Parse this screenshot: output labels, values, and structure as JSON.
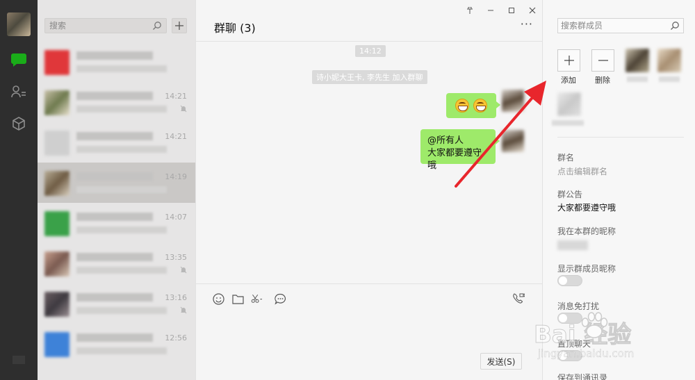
{
  "sidebar": {
    "icons": [
      "avatar",
      "chat-icon",
      "contacts-icon",
      "favorites-icon",
      "menu-icon"
    ]
  },
  "sessions": {
    "search_placeholder": "搜索",
    "items": [
      {
        "time": "",
        "muted": false,
        "color": "#e0373a"
      },
      {
        "time": "14:21",
        "muted": true,
        "color": "#9a9a82"
      },
      {
        "time": "14:21",
        "muted": false,
        "color": "#c8c8c8"
      },
      {
        "time": "14:19",
        "muted": false,
        "color": "#8a806e"
      },
      {
        "time": "14:07",
        "muted": false,
        "color": "#3aa149"
      },
      {
        "time": "13:35",
        "muted": true,
        "color": "#a37a6e"
      },
      {
        "time": "13:16",
        "muted": true,
        "color": "#6a5e62"
      },
      {
        "time": "12:56",
        "muted": false,
        "color": "#3e82d8"
      }
    ]
  },
  "chat": {
    "title": "群聊 (3)",
    "more": "···",
    "time_tip": "14:12",
    "join_tip": "诗小妮大王卡, 李先生 加入群聊",
    "message_line1": "@所有人",
    "message_line2": "大家都要遵守哦",
    "send_label": "发送(S)"
  },
  "info_panel": {
    "search_placeholder": "搜索群成员",
    "add_label": "添加",
    "remove_label": "删除",
    "group_name_label": "群名",
    "group_name_value": "点击编辑群名",
    "notice_label": "群公告",
    "notice_value": "大家都要遵守哦",
    "nickname_label": "我在本群的昵称",
    "show_nickname_label": "显示群成员昵称",
    "dnd_label": "消息免打扰",
    "pin_label": "置顶聊天",
    "save_contacts_label": "保存到通讯录",
    "toggles": {
      "show_nickname": false,
      "dnd": false,
      "pin": false
    }
  },
  "watermark": {
    "brand": "Bai 经验",
    "url": "jingyan.baidu.com"
  },
  "colors": {
    "sidebar_bg": "#2e2e2e",
    "accent_green": "#1aad19",
    "bubble_green": "#9eea6a",
    "arrow_red": "#e8262c"
  }
}
